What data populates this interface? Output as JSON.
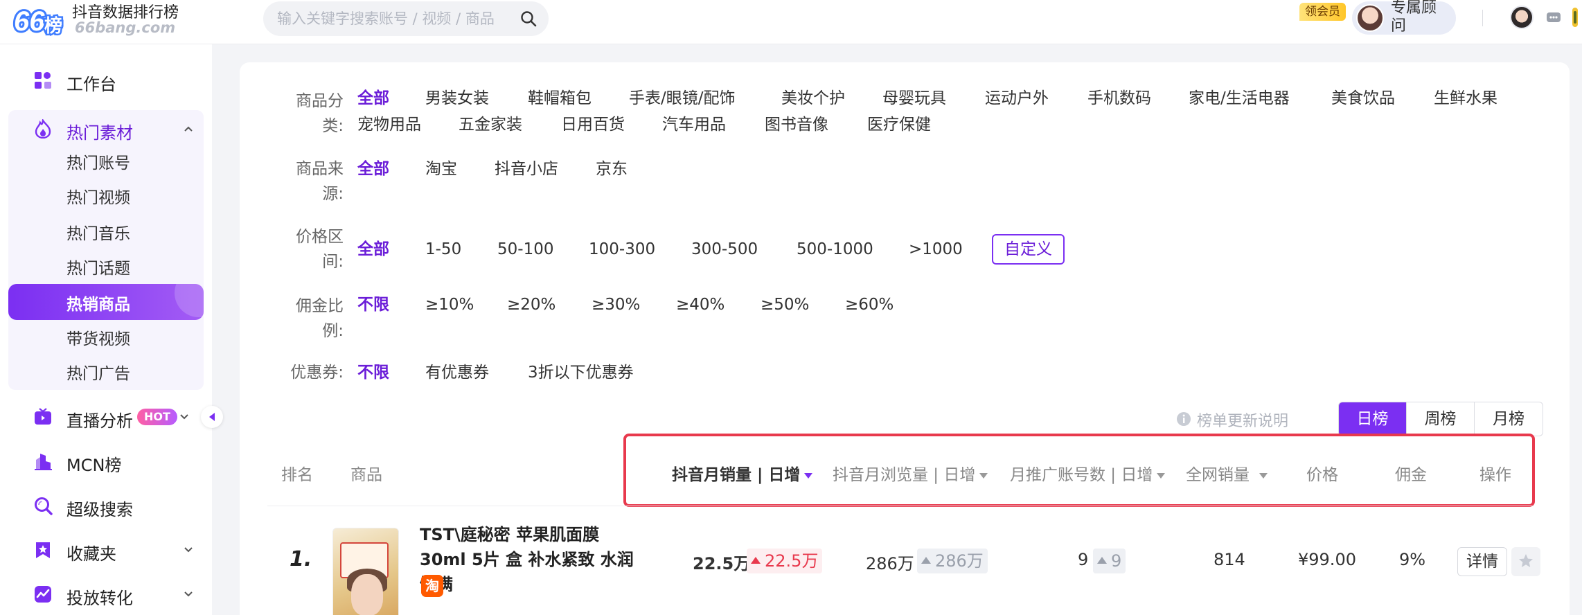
{
  "header": {
    "logo_mark": "66榜",
    "logo_title": "抖音数据排行榜",
    "logo_url": "66bang.com",
    "search_placeholder": "输入关键字搜索账号 / 视频 / 商品",
    "vip_badge": "领会员",
    "consultant_label": "专属顾问"
  },
  "sidebar": {
    "items": [
      {
        "label": "工作台",
        "icon": "dashboard-icon"
      },
      {
        "label": "热门素材",
        "icon": "flame-icon"
      },
      {
        "label": "直播分析",
        "icon": "live-tv-icon",
        "tag": "HOT"
      },
      {
        "label": "MCN榜",
        "icon": "building-icon"
      },
      {
        "label": "超级搜索",
        "icon": "search-icon"
      },
      {
        "label": "收藏夹",
        "icon": "favorites-icon"
      },
      {
        "label": "投放转化",
        "icon": "conversion-icon"
      }
    ],
    "hot_sub_items": [
      "热门账号",
      "热门视频",
      "热门音乐",
      "热门话题",
      "热销商品",
      "带货视频",
      "热门广告"
    ],
    "active_sub": "热销商品"
  },
  "filters": {
    "category": {
      "label": "商品分类:",
      "options": [
        "全部",
        "男装女装",
        "鞋帽箱包",
        "手表/眼镜/配饰",
        "美妆个护",
        "母婴玩具",
        "运动户外",
        "手机数码",
        "家电/生活电器",
        "美食饮品",
        "生鲜水果",
        "宠物用品",
        "五金家装",
        "日用百货",
        "汽车用品",
        "图书音像",
        "医疗保健"
      ],
      "selected": "全部"
    },
    "source": {
      "label": "商品来源:",
      "options": [
        "全部",
        "淘宝",
        "抖音小店",
        "京东"
      ],
      "selected": "全部"
    },
    "price": {
      "label": "价格区间:",
      "options": [
        "全部",
        "1-50",
        "50-100",
        "100-300",
        "300-500",
        "500-1000",
        ">1000"
      ],
      "custom": "自定义",
      "selected": "全部"
    },
    "commission": {
      "label": "佣金比例:",
      "options": [
        "不限",
        "≥10%",
        "≥20%",
        "≥30%",
        "≥40%",
        "≥50%",
        "≥60%"
      ],
      "selected": "不限"
    },
    "coupon": {
      "label": "优惠券:",
      "options": [
        "不限",
        "有优惠券",
        "3折以下优惠券"
      ],
      "selected": "不限"
    }
  },
  "ranking": {
    "update_note": "榜单更新说明",
    "tabs": [
      "日榜",
      "周榜",
      "月榜"
    ],
    "active_tab": "日榜"
  },
  "table": {
    "headers": {
      "rank": "排名",
      "product": "商品",
      "monthly_sales": "抖音月销量 | 日增",
      "monthly_views": "抖音月浏览量 | 日增",
      "promo_accounts": "月推广账号数 | 日增",
      "total_sales": "全网销量",
      "price": "价格",
      "commission": "佣金",
      "action": "操作"
    },
    "rows": [
      {
        "rank": "1.",
        "name": "TST\\庭秘密 苹果肌面膜 30ml 5片 盒 补水紧致 水润饱满",
        "platform_icon": "淘",
        "monthly_sales": "22.5万",
        "monthly_sales_inc": "22.5万",
        "monthly_views": "286万",
        "monthly_views_inc": "286万",
        "promo_accounts": "9",
        "promo_accounts_inc": "9",
        "total_sales": "814",
        "price": "¥99.00",
        "commission": "9%",
        "detail_label": "详情"
      }
    ]
  },
  "colors": {
    "accent": "#7b2ff2",
    "accent_text": "#6b1dd8",
    "highlight_border": "#e8394d",
    "increase_red": "#e8394d"
  }
}
